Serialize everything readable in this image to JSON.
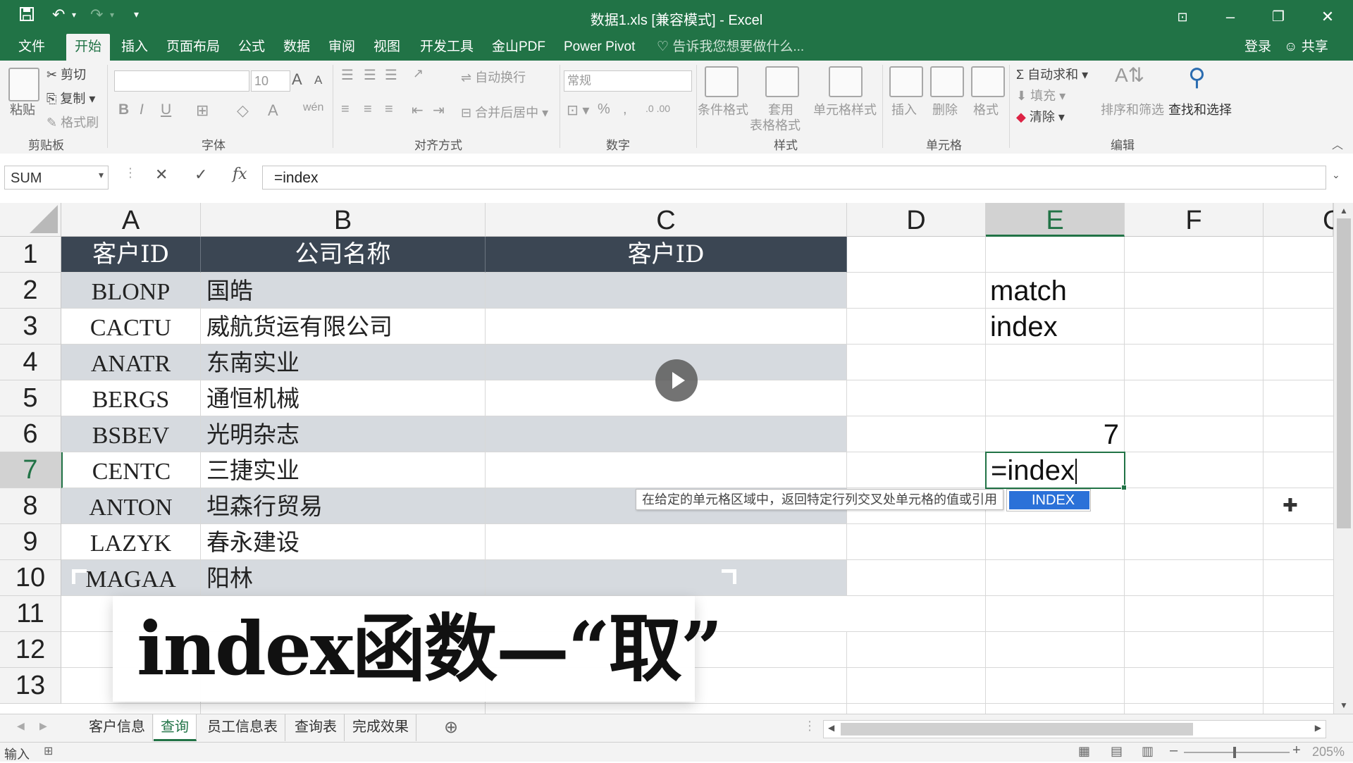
{
  "titlebar": {
    "title": "数据1.xls  [兼容模式] - Excel",
    "save_icon": "save-icon",
    "undo_icon": "undo-icon",
    "redo_icon": "redo-icon",
    "customize_icon": "customize-quick-access-icon"
  },
  "menu": {
    "tabs": [
      "文件",
      "开始",
      "插入",
      "页面布局",
      "公式",
      "数据",
      "审阅",
      "视图",
      "开发工具",
      "金山PDF",
      "Power Pivot"
    ],
    "active_tab": "开始",
    "tell_me": "告诉我您想要做什么...",
    "login": "登录",
    "share": "共享"
  },
  "ribbon": {
    "clipboard": {
      "paste": "粘贴",
      "cut": "剪切",
      "copy": "复制",
      "format_painter": "格式刷",
      "label": "剪贴板"
    },
    "font": {
      "font_name": "",
      "font_size": "10",
      "label": "字体",
      "bold": "B",
      "italic": "I",
      "underline": "U",
      "grow": "A",
      "shrink": "A",
      "color": "A",
      "phonetic": "wén"
    },
    "alignment": {
      "wrap_text": "自动换行",
      "merge_center": "合并后居中",
      "label": "对齐方式"
    },
    "number": {
      "format": "常规",
      "percent": "%",
      "comma": ",",
      "label": "数字"
    },
    "styles": {
      "conditional": "条件格式",
      "table_1": "套用",
      "table_2": "表格格式",
      "cell_styles": "单元格样式",
      "label": "样式"
    },
    "cells": {
      "insert": "插入",
      "delete": "删除",
      "format": "格式",
      "label": "单元格"
    },
    "editing": {
      "autosum": "自动求和",
      "fill": "填充",
      "clear": "清除",
      "sort_filter": "排序和筛选",
      "find_select": "查找和选择",
      "label": "编辑"
    }
  },
  "formula_bar": {
    "name_box": "SUM",
    "formula": "=index",
    "fx": "fx"
  },
  "grid": {
    "columns": [
      "A",
      "B",
      "C",
      "D",
      "E",
      "F",
      "G"
    ],
    "selected_column": "E",
    "rows": [
      "1",
      "2",
      "3",
      "4",
      "5",
      "6",
      "7",
      "8",
      "9",
      "10",
      "11",
      "12",
      "13"
    ],
    "selected_row": "7",
    "header": [
      "客户ID",
      "公司名称",
      "客户ID"
    ],
    "data": [
      {
        "id": "BLONP",
        "name": "国皓"
      },
      {
        "id": "CACTU",
        "name": "威航货运有限公司"
      },
      {
        "id": "ANATR",
        "name": "东南实业"
      },
      {
        "id": "BERGS",
        "name": "通恒机械"
      },
      {
        "id": "BSBEV",
        "name": "光明杂志"
      },
      {
        "id": "CENTC",
        "name": "三捷实业"
      },
      {
        "id": "ANTON",
        "name": "坦森行贸易"
      },
      {
        "id": "LAZYK",
        "name": "春永建设"
      },
      {
        "id": "MAGAA",
        "name": "阳林"
      }
    ],
    "e2": "match",
    "e3": "index",
    "e6": "7",
    "e7": "=index"
  },
  "autocomplete": {
    "tooltip": "在给定的单元格区域中，返回特定行列交叉处单元格的值或引用",
    "suggestion": "INDEX"
  },
  "caption": "index函数—“取”",
  "sheets": {
    "tabs": [
      "客户信息",
      "查询",
      "员工信息表",
      "查询表",
      "完成效果"
    ],
    "active": "查询"
  },
  "status": {
    "mode": "输入",
    "zoom": "205%"
  }
}
